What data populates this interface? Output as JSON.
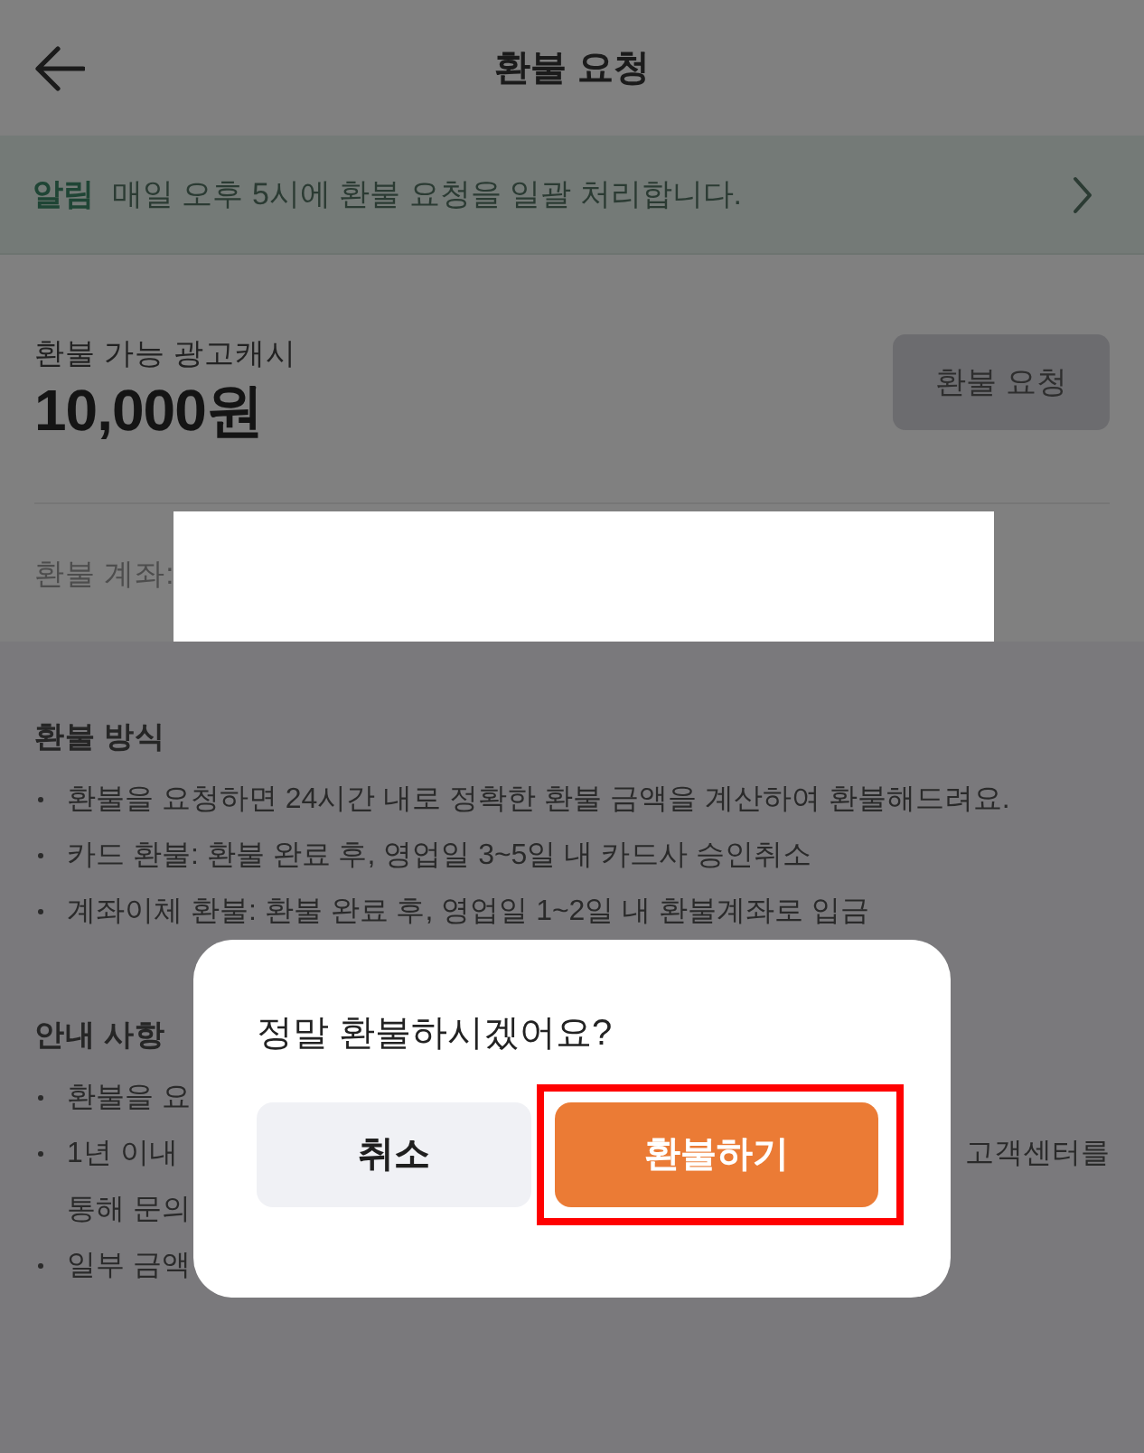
{
  "header": {
    "title": "환불 요청"
  },
  "notice": {
    "label": "알림",
    "text": "매일 오후 5시에 환불 요청을 일괄 처리합니다."
  },
  "balance": {
    "label": "환불 가능 광고캐시",
    "amount": "10,000원",
    "button": "환불 요청"
  },
  "account": {
    "label": "환불 계좌:"
  },
  "sections": [
    {
      "title": "환불 방식",
      "items": [
        {
          "lines": [
            [
              "환불을 요청하면 24시간 내로 정확한 환불 금액을 계산하여 환불해드려요."
            ]
          ]
        },
        {
          "lines": [
            [
              "카드 환불: 환불 완료 후, 영업일 3~5일 내 카드사 승인취소"
            ]
          ]
        },
        {
          "lines": [
            [
              "계좌이체 환불: 환불 완료 후, 영업일 1~2일 내 환불계좌로 입금"
            ]
          ]
        }
      ]
    },
    {
      "title": "안내 사항",
      "items": [
        {
          "lines": [
            [
              "환불을 요"
            ]
          ]
        },
        {
          "lines": [
            [
              "1년 이내",
              "고객센터를"
            ],
            [
              "통해 문의"
            ]
          ]
        },
        {
          "lines": [
            [
              "일부 금액"
            ]
          ]
        }
      ]
    }
  ],
  "dialog": {
    "message": "정말 환불하시겠어요?",
    "buttons": [
      {
        "label": "취소",
        "kind": "secondary",
        "highlighted": false
      },
      {
        "label": "환불하기",
        "kind": "primary",
        "highlighted": true
      }
    ]
  }
}
